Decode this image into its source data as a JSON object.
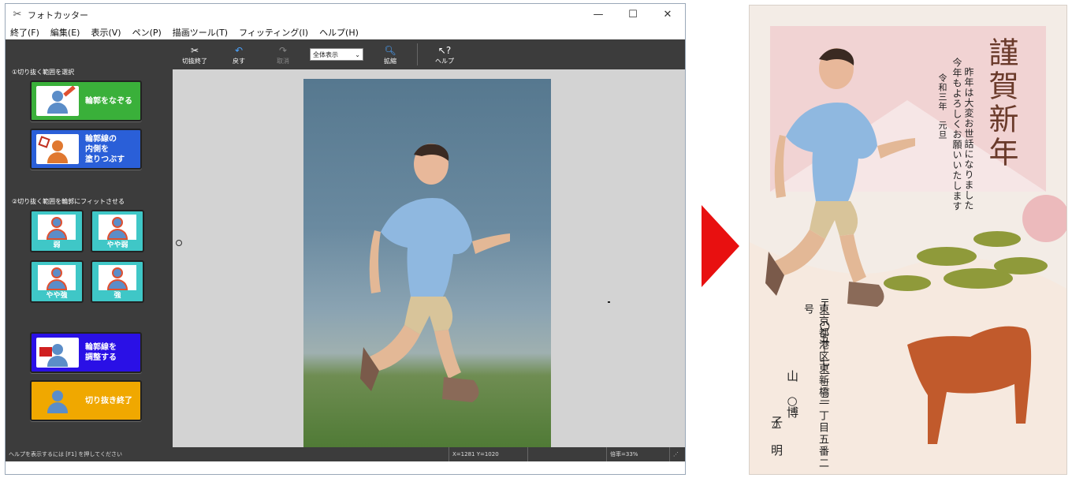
{
  "window": {
    "title": "フォトカッター",
    "controls": {
      "minimize": "—",
      "maximize": "☐",
      "close": "✕"
    }
  },
  "menu": [
    "終了(F)",
    "編集(E)",
    "表示(V)",
    "ペン(P)",
    "描画ツール(T)",
    "フィッティング(I)",
    "ヘルプ(H)"
  ],
  "left_panel": {
    "section1_label": "①切り抜く範囲を選択",
    "trace_button": "輪郭をなぞる",
    "fill_button": "輪郭線の\n内側を\n塗りつぶす",
    "section2_label": "②切り抜く範囲を輪郭にフィットさせる",
    "fit_weak": "弱",
    "fit_slightly_weak": "やや弱",
    "fit_slightly_strong": "やや強",
    "fit_strong": "強",
    "adjust_button": "輪郭線を\n調整する",
    "finish_button": "切り抜き終了"
  },
  "toolbar": {
    "finish_cut": "切抜終了",
    "undo": "戻す",
    "cancel": "取消",
    "zoom_value": "全体表示",
    "zoom_in": "拡縮",
    "help": "ヘルプ"
  },
  "status": {
    "hint": "ヘルプを表示するには [F1] を押してください",
    "coords": "X=1281 Y=1020",
    "zoom": "倍率=33%"
  },
  "card": {
    "greeting": "謹賀新年",
    "message_line1": "昨年は大変お世話になりました",
    "message_line2": "今年もよろしくお願いいたします",
    "date": "令和三年　元旦",
    "postal": "〒一〇五－七一三三",
    "address": "東京都港区東新橋一丁目五番二号",
    "name1": "山　博",
    "name1_mark": "○",
    "name2": "子 明",
    "name2_mark": "△"
  },
  "colors": {
    "trace_button": "#3ab03a",
    "fill_button": "#2a5fd8",
    "fit_buttons": "#3fc7c7",
    "adjust_button": "#2a10e6",
    "finish_button": "#f0a800",
    "arrow": "#e81010"
  }
}
